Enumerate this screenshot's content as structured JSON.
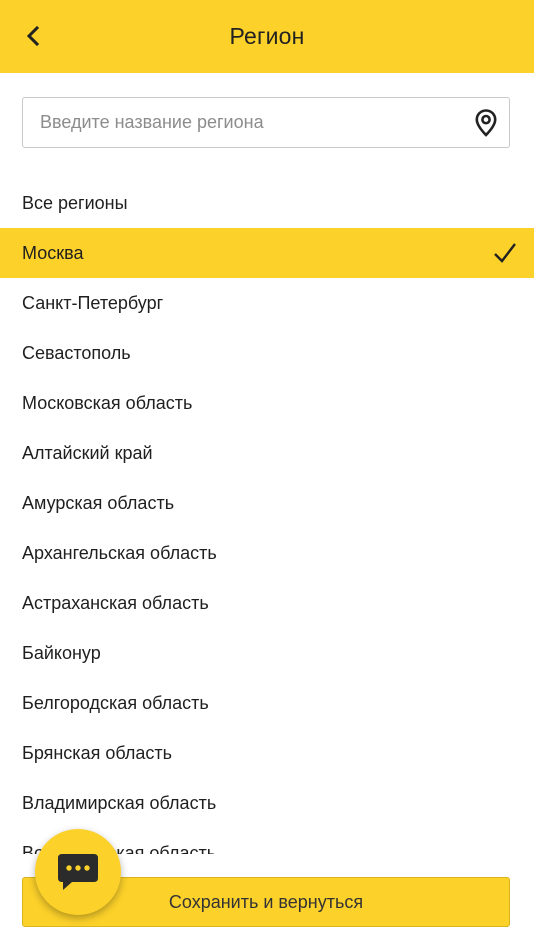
{
  "header": {
    "title": "Регион",
    "back_icon": "chevron-left-icon"
  },
  "search": {
    "placeholder": "Введите название региона",
    "value": "",
    "location_icon": "map-pin-icon"
  },
  "regions": {
    "items": [
      {
        "label": "Все регионы",
        "selected": false
      },
      {
        "label": "Москва",
        "selected": true
      },
      {
        "label": "Санкт-Петербург",
        "selected": false
      },
      {
        "label": "Севастополь",
        "selected": false
      },
      {
        "label": "Московская область",
        "selected": false
      },
      {
        "label": "Алтайский край",
        "selected": false
      },
      {
        "label": "Амурская область",
        "selected": false
      },
      {
        "label": "Архангельская область",
        "selected": false
      },
      {
        "label": "Астраханская область",
        "selected": false
      },
      {
        "label": "Байконур",
        "selected": false
      },
      {
        "label": "Белгородская область",
        "selected": false
      },
      {
        "label": "Брянская область",
        "selected": false
      },
      {
        "label": "Владимирская область",
        "selected": false
      },
      {
        "label": "Волгоградская область",
        "selected": false
      }
    ],
    "selected_icon": "checkmark-icon"
  },
  "footer": {
    "save_label": "Сохранить и вернуться"
  },
  "chat": {
    "icon": "chat-bubble-icon"
  },
  "colors": {
    "accent": "#fcd12a",
    "text": "#1f1f1f",
    "placeholder": "#8c8c8c",
    "border": "#c9c9c9"
  }
}
